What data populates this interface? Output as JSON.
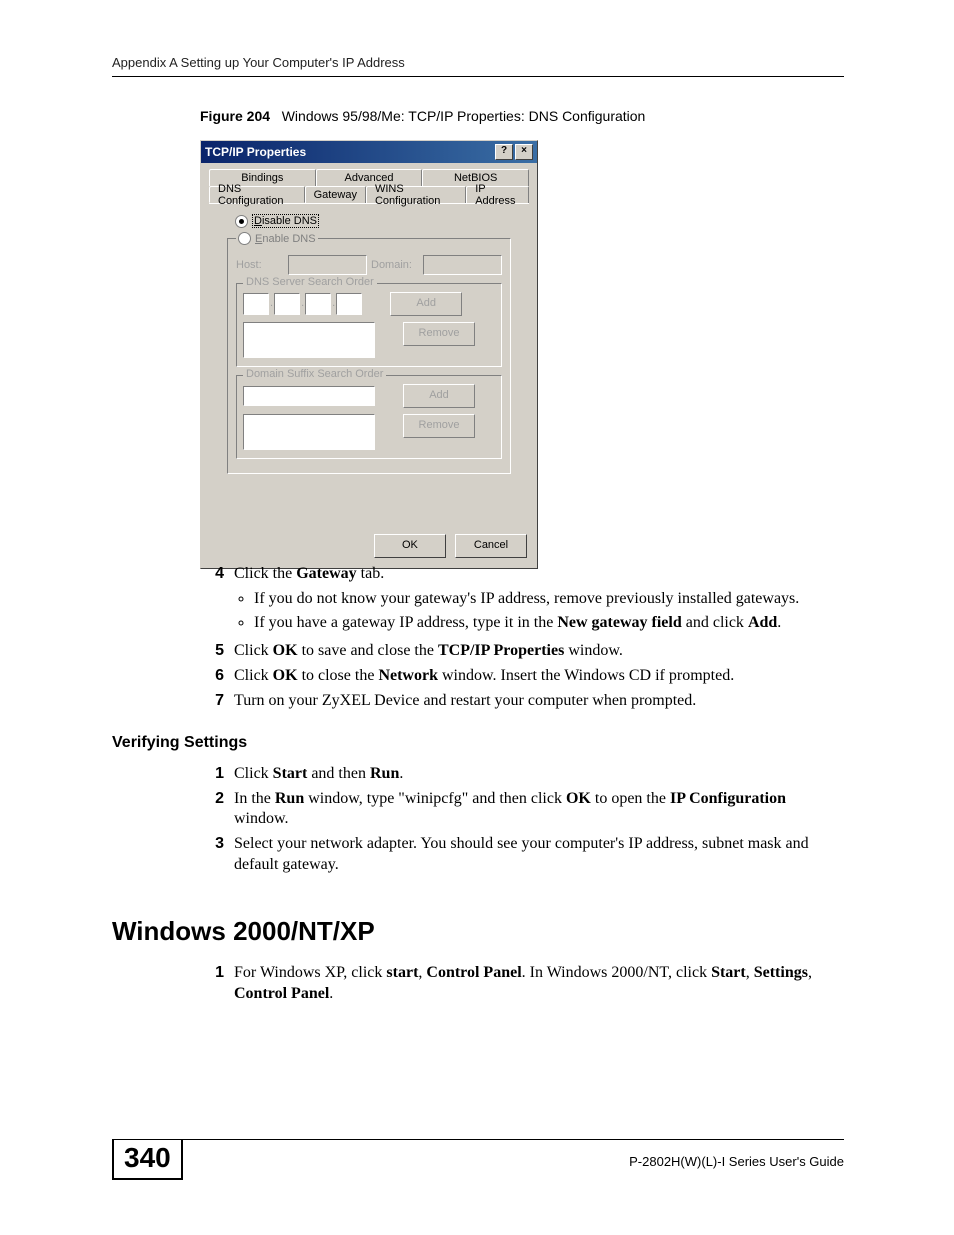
{
  "header": "Appendix A Setting up Your Computer's IP Address",
  "figure": {
    "label": "Figure 204",
    "title": "Windows 95/98/Me: TCP/IP Properties: DNS Configuration"
  },
  "dialog": {
    "title": "TCP/IP Properties",
    "help": "?",
    "close": "×",
    "tabs_row1": [
      "Bindings",
      "Advanced",
      "NetBIOS"
    ],
    "tabs_row2": [
      "DNS Configuration",
      "Gateway",
      "WINS Configuration",
      "IP Address"
    ],
    "active_tab": "DNS Configuration",
    "disable_label": "Disable DNS",
    "enable_label": "Enable DNS",
    "host_label": "Host:",
    "domain_label": "Domain:",
    "dnsorder_label": "DNS Server Search Order",
    "suffixorder_label": "Domain Suffix Search Order",
    "btn_add": "Add",
    "btn_remove": "Remove",
    "btn_ok": "OK",
    "btn_cancel": "Cancel"
  },
  "steps_a": {
    "n4": "4",
    "t4_a": "Click the ",
    "t4_b": "Gateway",
    "t4_c": " tab.",
    "b1": "If you do not know your gateway's IP address, remove previously installed gateways.",
    "b2_a": "If you have a gateway IP address, type it in the ",
    "b2_b": "New gateway field",
    "b2_c": " and click ",
    "b2_d": "Add",
    "b2_e": ".",
    "n5": "5",
    "t5_a": "Click ",
    "t5_b": "OK",
    "t5_c": " to save and close the ",
    "t5_d": "TCP/IP Properties",
    "t5_e": " window.",
    "n6": "6",
    "t6_a": "Click ",
    "t6_b": "OK",
    "t6_c": " to close the ",
    "t6_d": "Network",
    "t6_e": " window. Insert the Windows CD if prompted.",
    "n7": "7",
    "t7": "Turn on your ZyXEL Device and restart your computer when prompted."
  },
  "verify_heading": "Verifying Settings",
  "steps_b": {
    "n1": "1",
    "t1_a": "Click ",
    "t1_b": "Start",
    "t1_c": " and then ",
    "t1_d": "Run",
    "t1_e": ".",
    "n2": "2",
    "t2_a": "In the ",
    "t2_b": "Run",
    "t2_c": " window, type \"winipcfg\" and then click ",
    "t2_d": "OK",
    "t2_e": " to open the ",
    "t2_f": "IP Configuration",
    "t2_g": " window.",
    "n3": "3",
    "t3": "Select your network adapter. You should see your computer's IP address, subnet mask and default gateway."
  },
  "winheading": "Windows 2000/NT/XP",
  "steps_c": {
    "n1": "1",
    "t1_a": "For Windows XP, click ",
    "t1_b": "start",
    "t1_c": ", ",
    "t1_d": "Control Panel",
    "t1_e": ". In Windows 2000/NT, click ",
    "t1_f": "Start",
    "t1_g": ", ",
    "t1_h": "Settings",
    "t1_i": ", ",
    "t1_j": "Control Panel",
    "t1_k": "."
  },
  "page_number": "340",
  "doc_name": "P-2802H(W)(L)-I Series User's Guide"
}
